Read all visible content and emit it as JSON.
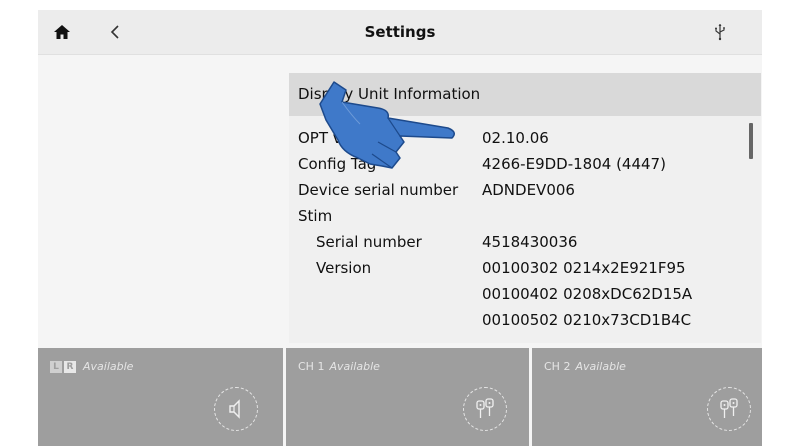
{
  "header": {
    "title": "Settings",
    "home_icon": "home-icon",
    "back_icon": "back-chevron-icon",
    "usb_icon": "usb-icon"
  },
  "panel": {
    "title": "Display Unit Information",
    "rows": [
      {
        "label": "OPT version",
        "value": "02.10.06"
      },
      {
        "label": "Config Tag",
        "value": "4266-E9DD-1804 (4447)"
      },
      {
        "label": "Device serial number",
        "value": "ADNDEV006"
      },
      {
        "label": "Stim",
        "value": ""
      },
      {
        "label": "Serial number",
        "value": "4518430036"
      },
      {
        "label": "Version",
        "value": "00100302 0214x2E921F95"
      },
      {
        "label": "",
        "value": "00100402 0208xDC62D15A"
      },
      {
        "label": "",
        "value": "00100502 0210x73CD1B4C"
      }
    ]
  },
  "cards": [
    {
      "prefix_l": "L",
      "prefix_r": "R",
      "status": "Available",
      "icon": "speaker-icon"
    },
    {
      "channel": "CH 1",
      "status": "Available",
      "icon": "electrode-pair-icon"
    },
    {
      "channel": "CH 2",
      "status": "Available",
      "icon": "electrode-pair-icon"
    }
  ],
  "colors": {
    "header_bg": "#ececec",
    "panel_bg": "#f0f0f0",
    "panel_header_bg": "#d9d9d9",
    "card_bg": "#9e9e9e",
    "hand_blue": "#3f79c9"
  }
}
